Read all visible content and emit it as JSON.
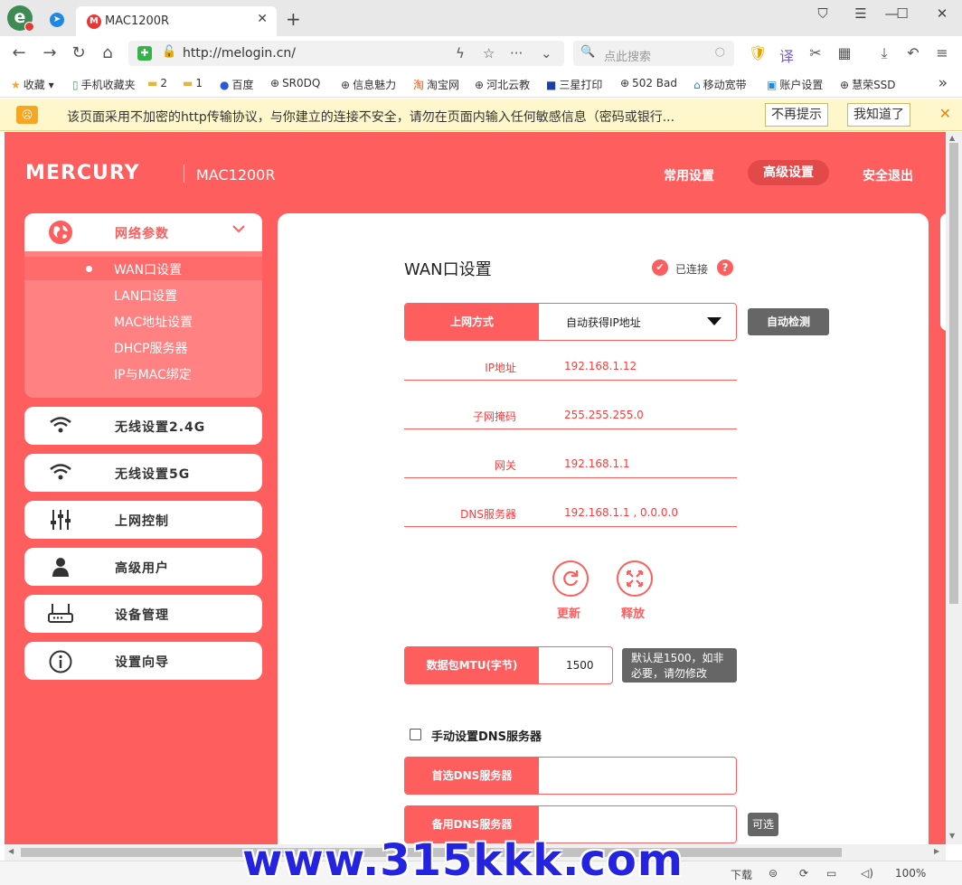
{
  "browser": {
    "tab_title": "MAC1200R",
    "url": "http://melogin.cn/",
    "search_placeholder": "点此搜索",
    "new_tab": "+",
    "tab_close": "✕",
    "tab_fav": "M"
  },
  "bookmarks": [
    {
      "label": "收藏",
      "icon": "star-icon"
    },
    {
      "label": "手机收藏夹",
      "icon": "phone-icon"
    },
    {
      "label": "2",
      "icon": "folder-icon"
    },
    {
      "label": "1",
      "icon": "folder-icon"
    },
    {
      "label": "百度",
      "icon": "baidu-icon"
    },
    {
      "label": "SR0DQ",
      "icon": "globe-icon"
    },
    {
      "label": "信息魅力",
      "icon": "globe-icon"
    },
    {
      "label": "淘宝网",
      "icon": "taobao-icon"
    },
    {
      "label": "河北云教",
      "icon": "globe-icon"
    },
    {
      "label": "三星打印",
      "icon": "samsung-icon"
    },
    {
      "label": "502 Bad",
      "icon": "globe-icon"
    },
    {
      "label": "移动宽带",
      "icon": "home-icon"
    },
    {
      "label": "账户设置",
      "icon": "account-icon"
    },
    {
      "label": "慧荣SSD",
      "icon": "globe-icon"
    }
  ],
  "warning": {
    "text": "该页面采用不加密的http传输协议，与你建立的连接不安全，请勿在页面内输入任何敏感信息（密码或银行...",
    "dismiss_forever": "不再提示",
    "acknowledge": "我知道了"
  },
  "header": {
    "brand": "MERCURY",
    "model": "MAC1200R",
    "nav": [
      "常用设置",
      "高级设置",
      "安全退出"
    ]
  },
  "sidebar": {
    "group": {
      "label": "网络参数",
      "items": [
        "WAN口设置",
        "LAN口设置",
        "MAC地址设置",
        "DHCP服务器",
        "IP与MAC绑定"
      ]
    },
    "items": [
      {
        "label": "无线设置2.4G",
        "icon": "wifi-icon"
      },
      {
        "label": "无线设置5G",
        "icon": "wifi-icon"
      },
      {
        "label": "上网控制",
        "icon": "sliders-icon"
      },
      {
        "label": "高级用户",
        "icon": "user-icon"
      },
      {
        "label": "设备管理",
        "icon": "router-icon"
      },
      {
        "label": "设置向导",
        "icon": "info-icon"
      }
    ]
  },
  "wan": {
    "title": "WAN口设置",
    "status": "已连接",
    "connection_type_label": "上网方式",
    "connection_type_value": "自动获得IP地址",
    "auto_detect": "自动检测",
    "info": [
      {
        "label": "IP地址",
        "value": "192.168.1.12"
      },
      {
        "label": "子网掩码",
        "value": "255.255.255.0"
      },
      {
        "label": "网关",
        "value": "192.168.1.1"
      },
      {
        "label": "DNS服务器",
        "value": "192.168.1.1 , 0.0.0.0"
      }
    ],
    "renew": "更新",
    "release": "释放",
    "mtu_label": "数据包MTU(字节)",
    "mtu_value": "1500",
    "mtu_hint_1": "默认是1500，如非",
    "mtu_hint_2": "必要，请勿修改",
    "manual_dns": "手动设置DNS服务器",
    "primary_dns_label": "首选DNS服务器",
    "secondary_dns_label": "备用DNS服务器",
    "optional": "可选"
  },
  "statusbar": {
    "download": "下载",
    "zoom": "100%"
  },
  "watermark": "www.315kkk.com"
}
